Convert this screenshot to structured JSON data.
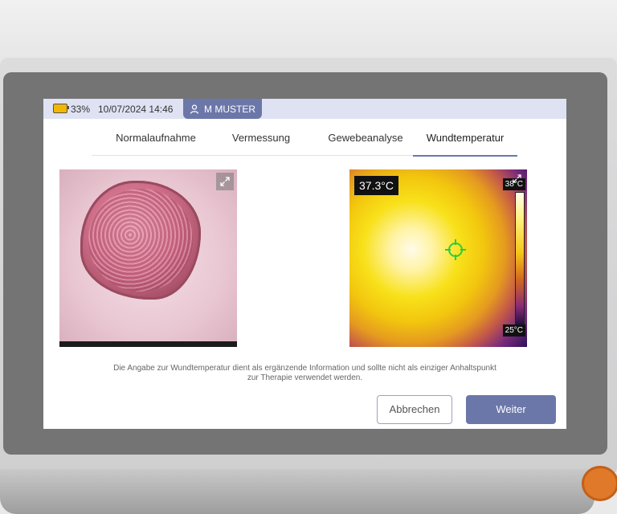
{
  "status": {
    "battery_percent": "33%",
    "battery_level": 0.33,
    "datetime": "10/07/2024 14:46",
    "user": "M MUSTER"
  },
  "tabs": [
    {
      "label": "Normalaufnahme",
      "active": false
    },
    {
      "label": "Vermessung",
      "active": false
    },
    {
      "label": "Gewebeanalyse",
      "active": false
    },
    {
      "label": "Wundtemperatur",
      "active": true
    }
  ],
  "thermal": {
    "measured_temp": "37.3°C",
    "scale_max": "38°C",
    "scale_min": "25°C"
  },
  "disclaimer": "Die Angabe zur Wundtemperatur dient als ergänzende Information und sollte nicht als einziger Anhaltspunkt zur Therapie verwendet werden.",
  "buttons": {
    "cancel": "Abbrechen",
    "next": "Weiter"
  },
  "colors": {
    "accent": "#6b77a8",
    "status_bar": "#dfe2f3",
    "battery": "#f2b705",
    "crosshair": "#2ecc40"
  },
  "icons": [
    "battery-icon",
    "user-icon",
    "expand-icon",
    "crosshair-icon"
  ]
}
